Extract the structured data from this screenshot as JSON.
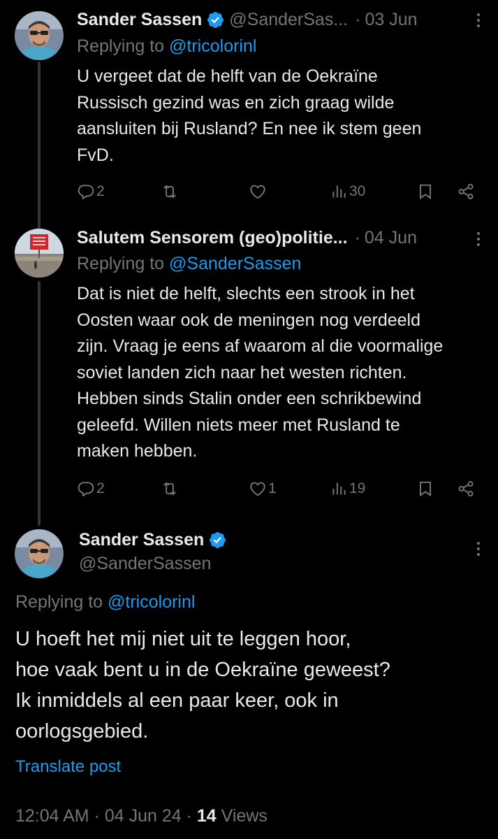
{
  "tweets": [
    {
      "name": "Sander Sassen",
      "handle": "@SanderSas...",
      "date": "03 Jun",
      "replying_prefix": "Replying to ",
      "replying_to": "@tricolorinl",
      "text": "U vergeet dat de helft van de Oekraïne\nRussisch gezind was en zich graag wilde\naansluiten bij Rusland? En nee ik stem geen\nFvD.",
      "stats": {
        "replies": "2",
        "reposts": "",
        "likes": "",
        "views": "30"
      }
    },
    {
      "name": "Salutem Sensorem (geo)politie...",
      "date": "04 Jun",
      "replying_prefix": "Replying to ",
      "replying_to": "@SanderSassen",
      "text": "Dat is niet de helft, slechts een strook in het\nOosten waar ook de meningen nog verdeeld\nzijn. Vraag je eens af waarom al die voormalige\nsoviet landen zich naar het westen richten.\nHebben sinds Stalin onder een schrikbewind\ngeleefd. Willen niets meer met Rusland te\nmaken hebben.",
      "stats": {
        "replies": "2",
        "reposts": "",
        "likes": "1",
        "views": "19"
      }
    }
  ],
  "main_tweet": {
    "name": "Sander Sassen",
    "handle": "@SanderSassen",
    "replying_prefix": "Replying to ",
    "replying_to": "@tricolorinl",
    "text": "U hoeft het mij niet uit te leggen hoor,\nhoe vaak bent u in de Oekraïne geweest?\nIk inmiddels al een paar keer, ook in\noorlogsgebied.",
    "translate": "Translate post",
    "time": "12:04 AM",
    "date": "04 Jun 24",
    "separator": " · ",
    "views_count": "14",
    "views_label": " Views"
  },
  "colors": {
    "background": "#000000",
    "text": "#e7e9ea",
    "muted": "#71767b",
    "accent": "#1d9bf0",
    "thread_line": "#333639"
  },
  "icons": [
    "more-icon",
    "verified-badge-icon",
    "reply-icon",
    "repost-icon",
    "like-icon",
    "views-icon",
    "bookmark-icon",
    "share-icon"
  ]
}
